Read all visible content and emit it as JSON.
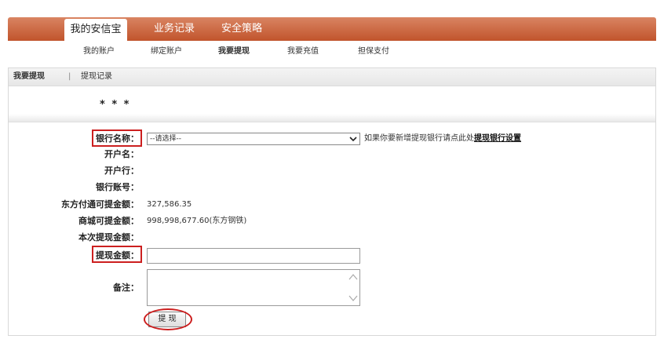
{
  "top_tabs": [
    {
      "label": "我的安信宝",
      "active": true
    },
    {
      "label": "业务记录",
      "active": false
    },
    {
      "label": "安全策略",
      "active": false
    }
  ],
  "sub_nav": [
    {
      "label": "我的账户",
      "active": false
    },
    {
      "label": "绑定账户",
      "active": false
    },
    {
      "label": "我要提现",
      "active": true
    },
    {
      "label": "我要充值",
      "active": false
    },
    {
      "label": "担保支付",
      "active": false
    }
  ],
  "panel_tabs": {
    "withdraw": "我要提现",
    "separator": "|",
    "records": "提现记录"
  },
  "masked_user": "* * *",
  "form": {
    "bank_name_label": "银行名称：",
    "bank_select_value": "--请选择--",
    "hint_text": "如果你要新增提现银行请点此处",
    "hint_link": "提现银行设置",
    "account_name_label": "开户名：",
    "bank_branch_label": "开户行：",
    "account_number_label": "银行账号：",
    "dfft_available_label": "东方付通可提金额：",
    "dfft_available_value": "327,586.35",
    "mall_available_label": "商城可提金额：",
    "mall_available_value": "998,998,677.60(东方钢铁)",
    "current_withdraw_label": "本次提现金额：",
    "amount_label": "提现金额：",
    "amount_value": "",
    "remark_label": "备注：",
    "remark_value": "",
    "submit_label": "提 现"
  },
  "colors": {
    "nav_top": "#d98462",
    "nav_bottom": "#c1542c",
    "highlight": "#cc1f1f"
  }
}
